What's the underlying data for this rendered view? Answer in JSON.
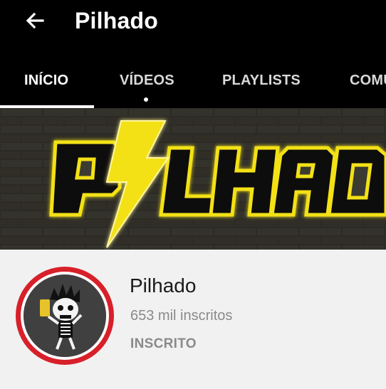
{
  "appbar": {
    "back_icon": "arrow-left-icon",
    "title": "Pilhado"
  },
  "tabs": [
    {
      "label": "INÍCIO",
      "active": true
    },
    {
      "label": "VÍDEOS",
      "active": false,
      "has_new_dot": true
    },
    {
      "label": "PLAYLISTS",
      "active": false
    },
    {
      "label": "COMU",
      "active": false
    }
  ],
  "banner": {
    "logo_text": "PILHADO",
    "accent": "#f3e117",
    "background": "#3b3a33"
  },
  "channel": {
    "name": "Pilhado",
    "subscribers": "653 mil inscritos",
    "subscribe_state": "INSCRITO",
    "avatar_ring_color": "#d8202a",
    "avatar_icon": "skeleton-mascot-icon"
  }
}
